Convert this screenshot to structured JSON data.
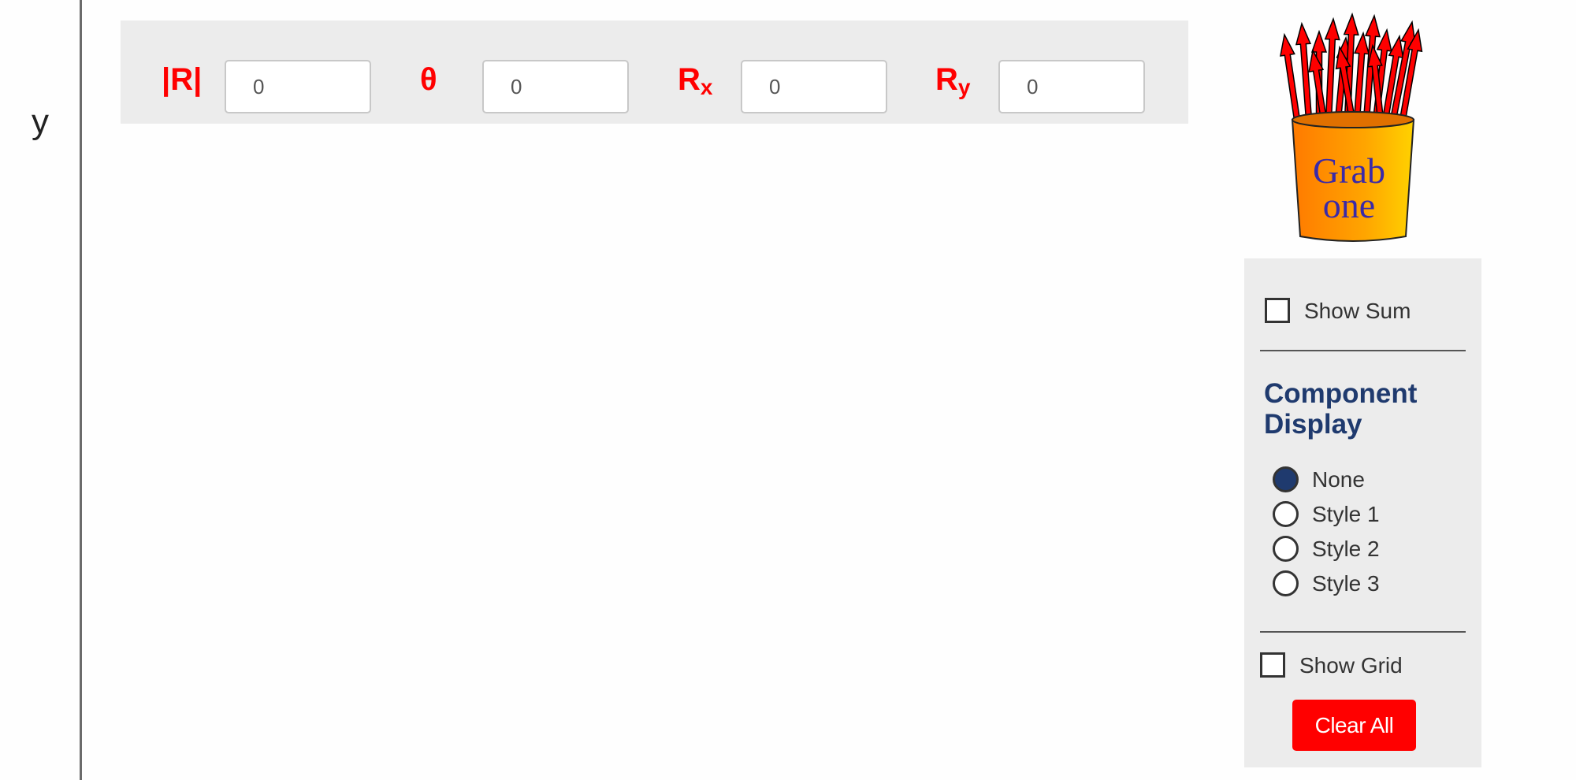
{
  "axis": {
    "y_label": "y"
  },
  "fields": [
    {
      "label": "|R|",
      "sub": "",
      "value": "0"
    },
    {
      "label": "θ",
      "sub": "",
      "value": "0"
    },
    {
      "label": "R",
      "sub": "x",
      "value": "0"
    },
    {
      "label": "R",
      "sub": "y",
      "value": "0"
    }
  ],
  "cup": {
    "text_line1": "Grab",
    "text_line2": "one",
    "arrow_color": "#ff0000",
    "cup_color": "#ffa500"
  },
  "panel": {
    "show_sum_label": "Show Sum",
    "show_sum_checked": false,
    "component_heading_line1": "Component",
    "component_heading_line2": "Display",
    "options": [
      "None",
      "Style 1",
      "Style 2",
      "Style 3"
    ],
    "selected_option": "None",
    "show_grid_label": "Show Grid",
    "show_grid_checked": false,
    "clear_label": "Clear All"
  },
  "colors": {
    "accent_red": "#ff0000",
    "heading_blue": "#1f3a6e",
    "panel_bg": "#ececec"
  }
}
